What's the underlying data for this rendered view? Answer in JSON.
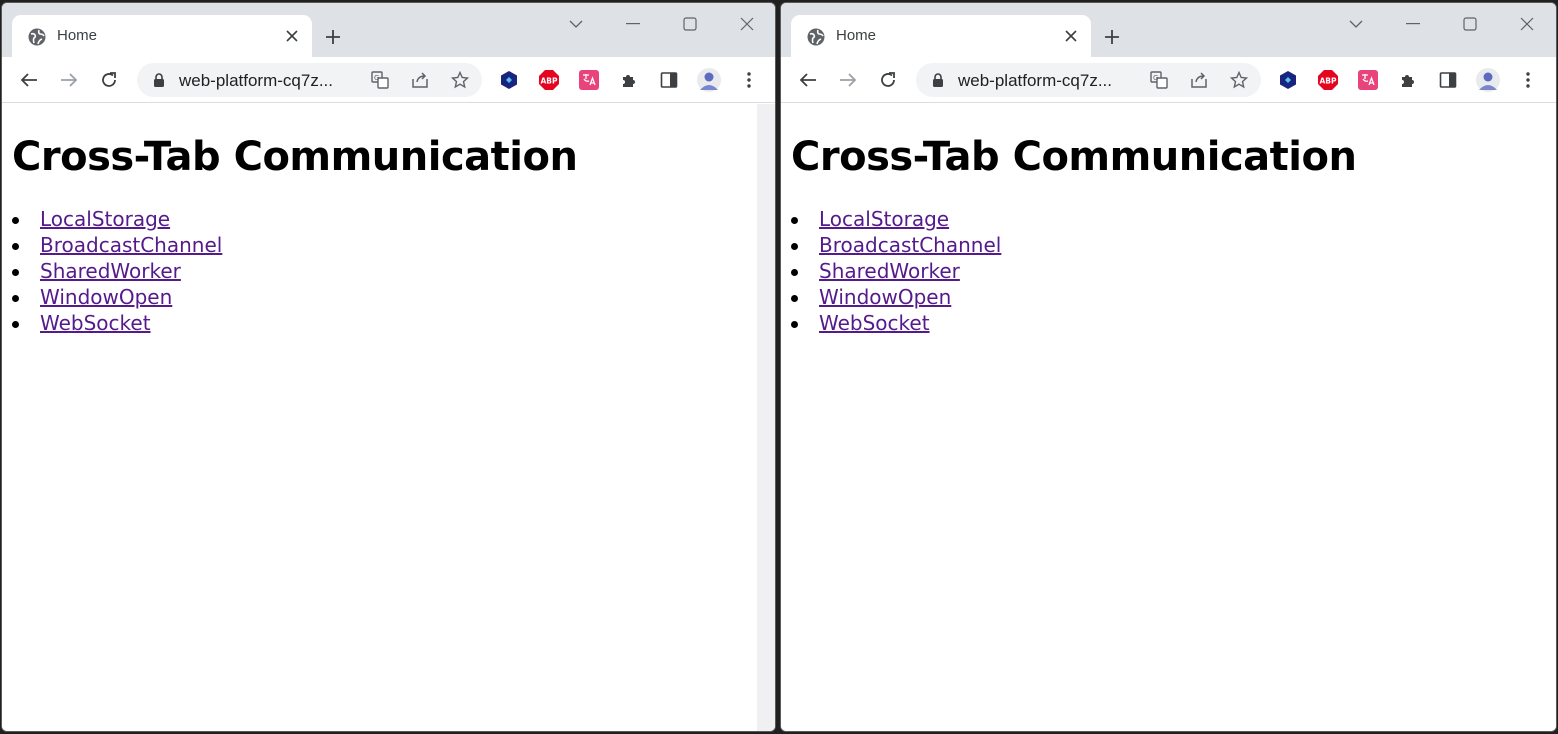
{
  "windows": [
    {
      "tab": {
        "title": "Home"
      },
      "address": {
        "url": "web-platform-cq7z..."
      },
      "page": {
        "heading": "Cross-Tab Communication",
        "links": [
          "LocalStorage",
          "BroadcastChannel",
          "SharedWorker",
          "WindowOpen",
          "WebSocket"
        ]
      }
    },
    {
      "tab": {
        "title": "Home"
      },
      "address": {
        "url": "web-platform-cq7z..."
      },
      "page": {
        "heading": "Cross-Tab Communication",
        "links": [
          "LocalStorage",
          "BroadcastChannel",
          "SharedWorker",
          "WindowOpen",
          "WebSocket"
        ]
      }
    }
  ],
  "extensions": {
    "abp_label": "ABP"
  },
  "colors": {
    "link": "#551a8b",
    "tabstrip": "#dee1e6",
    "omnibox": "#f1f3f4",
    "abp_red": "#e40521",
    "translate_pink": "#e8437a"
  }
}
